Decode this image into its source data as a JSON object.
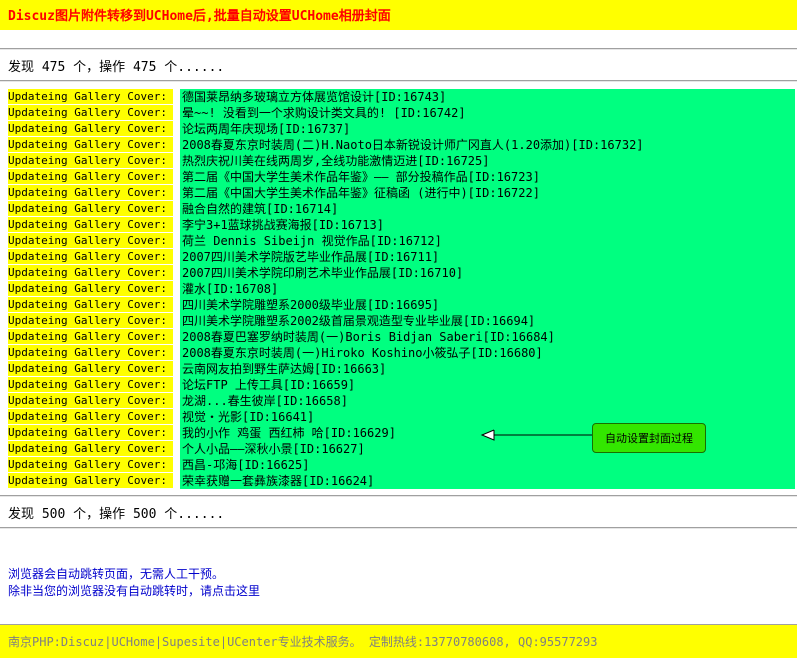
{
  "header": {
    "title": "Discuz图片附件转移到UCHome后,批量自动设置UCHome相册封面"
  },
  "stats": {
    "before": "发现 475 个，操作 475 个......",
    "after": "发现 500 个，操作 500 个......"
  },
  "log": {
    "label": "Updateing Gallery Cover:",
    "items": [
      "德国莱昂纳多玻璃立方体展览馆设计[ID:16743]",
      "晕~~! 没看到一个求购设计类文具的! [ID:16742]",
      "论坛两周年庆现场[ID:16737]",
      "2008春夏东京时装周(二)H.Naoto日本新锐设计师广冈直人(1.20添加)[ID:16732]",
      "热烈庆祝川美在线两周岁,全线功能激情迈进[ID:16725]",
      "第二届《中国大学生美术作品年鉴》—— 部分投稿作品[ID:16723]",
      "第二届《中国大学生美术作品年鉴》征稿函 (进行中)[ID:16722]",
      "融合自然的建筑[ID:16714]",
      "李宁3+1蓝球挑战赛海报[ID:16713]",
      "荷兰 Dennis Sibeijn 视觉作品[ID:16712]",
      "2007四川美术学院版艺毕业作品展[ID:16711]",
      "2007四川美术学院印刷艺术毕业作品展[ID:16710]",
      "灌水[ID:16708]",
      "四川美术学院雕塑系2000级毕业展[ID:16695]",
      "四川美术学院雕塑系2002级首届景观造型专业毕业展[ID:16694]",
      "2008春夏巴塞罗纳时装周(一)Boris Bidjan Saberi[ID:16684]",
      "2008春夏东京时装周(一)Hiroko Koshino小筱弘子[ID:16680]",
      "云南网友拍到野生萨达姆[ID:16663]",
      "论坛FTP 上传工具[ID:16659]",
      "龙湖...春生彼岸[ID:16658]",
      "视觉・光影[ID:16641]",
      "我的小作 鸡蛋 西红柿 哈[ID:16629]",
      "个人小品——深秋小景[ID:16627]",
      "西昌-邛海[ID:16625]",
      "荣幸获赠一套彝族漆器[ID:16624]"
    ]
  },
  "callout": {
    "text": "自动设置封面过程"
  },
  "links": {
    "auto_redirect": "浏览器会自动跳转页面，无需人工干预。",
    "manual_redirect": "除非当您的浏览器没有自动跳转时，请点击这里"
  },
  "footer": {
    "text": "南京PHP:Discuz|UCHome|Supesite|UCenter专业技术服务。 定制热线:13770780608, QQ:95577293"
  },
  "colors": {
    "highlight_yellow": "#ffff00",
    "highlight_green": "#00ff80",
    "title_red": "#ff0000",
    "link_blue": "#0000cc",
    "callout_green": "#33e600"
  }
}
